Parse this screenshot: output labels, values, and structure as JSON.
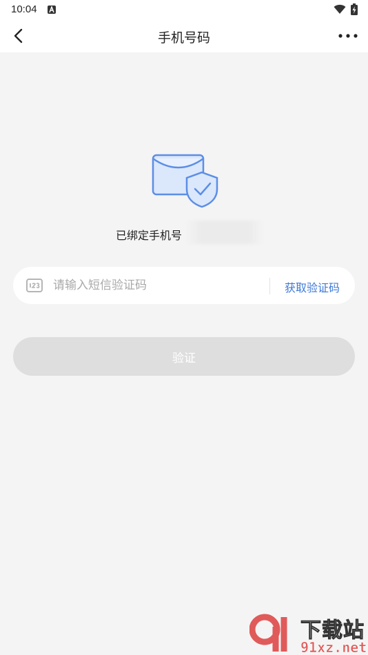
{
  "status_bar": {
    "time": "10:04",
    "icons": [
      "notification-a-icon",
      "wifi-icon",
      "battery-charging-icon"
    ]
  },
  "nav": {
    "title": "手机号码",
    "back_icon": "chevron-left-icon",
    "more_icon": "more-horizontal-icon"
  },
  "main": {
    "illustration_icon": "envelope-shield-icon",
    "bound_label": "已绑定手机号",
    "code_field": {
      "icon": "numeric-keypad-icon",
      "placeholder": "请输入短信验证码",
      "value": "",
      "get_code_label": "获取验证码"
    },
    "verify_label": "验证"
  },
  "watermark": {
    "top_text": "下载站",
    "bottom_text": "91xz.net"
  },
  "colors": {
    "background": "#f4f4f4",
    "accent": "#3c78d8",
    "button_disabled": "#dedede",
    "illustration_blue": "#5b8ee6"
  }
}
